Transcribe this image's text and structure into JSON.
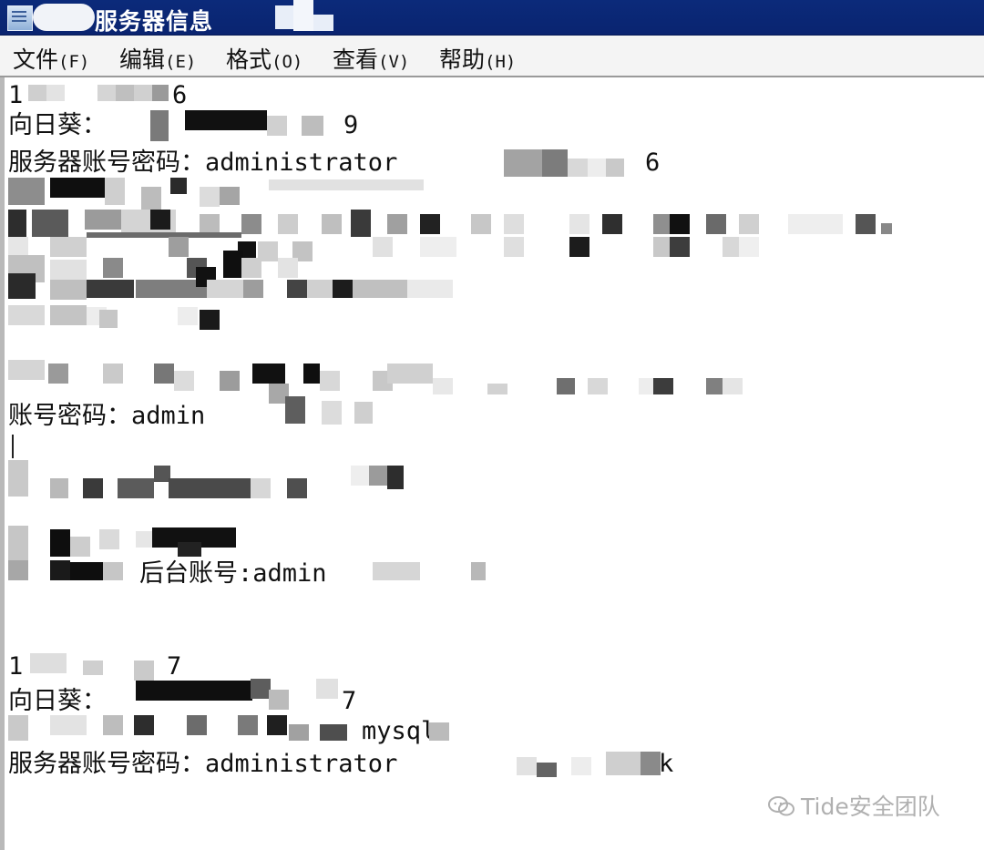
{
  "window": {
    "title": "服务器信息"
  },
  "menu": {
    "items": [
      {
        "label": "文件",
        "accel": "(F)"
      },
      {
        "label": "编辑",
        "accel": "(E)"
      },
      {
        "label": "格式",
        "accel": "(O)"
      },
      {
        "label": "查看",
        "accel": "(V)"
      },
      {
        "label": "帮助",
        "accel": "(H)"
      }
    ]
  },
  "content": {
    "block1": {
      "ip_fragment_start": "1",
      "ip_fragment_end": "6",
      "sunflower_label": "向日葵：",
      "sunflower_tail": "9",
      "server_cred_label": "服务器账号密码：administrator",
      "server_cred_tail": "6"
    },
    "block2": {
      "account_label": "账号密码：admin"
    },
    "block3": {
      "backend_label": "后台账号:admin"
    },
    "block4": {
      "ip_fragment_start": "1",
      "ip_fragment_end": "7",
      "sunflower_label": "向日葵：",
      "sunflower_tail": "7",
      "mysql_tail": "mysql",
      "server_cred_label": "服务器账号密码：administrator",
      "server_cred_tail": "k"
    }
  },
  "watermark": {
    "text": "Tide安全团队"
  },
  "colors": {
    "titlebar": "#0a2470",
    "menubar": "#f4f4f4",
    "text": "#111111",
    "watermark": "#b0b0b0"
  }
}
